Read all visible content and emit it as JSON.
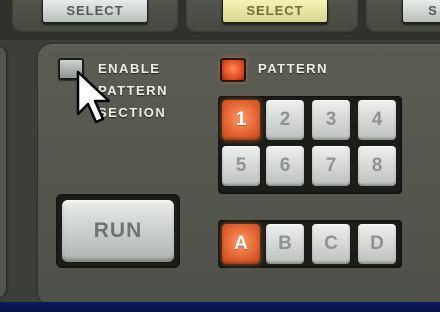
{
  "top_bar": {
    "select_buttons": [
      {
        "label": "SELECT",
        "active": false
      },
      {
        "label": "SELECT",
        "active": true
      },
      {
        "label": "S",
        "active": false
      }
    ]
  },
  "section": {
    "enable_checkbox": {
      "label_lines": [
        "ENABLE",
        "PATTERN",
        "SECTION"
      ],
      "checked": false
    },
    "pattern_indicator": {
      "label": "PATTERN",
      "lit": true,
      "color": "#e8552a"
    },
    "pattern_buttons": {
      "labels": [
        "1",
        "2",
        "3",
        "4",
        "5",
        "6",
        "7",
        "8"
      ],
      "selected": "1"
    },
    "bank_buttons": {
      "labels": [
        "A",
        "B",
        "C",
        "D"
      ],
      "selected": "A"
    },
    "run_button": {
      "label": "RUN"
    }
  },
  "colors": {
    "active_orange": "#e0602e",
    "panel_dark": "#4e5149",
    "select_active": "#f4f3b6"
  },
  "cursor": {
    "icon": "arrow-cursor-icon"
  }
}
